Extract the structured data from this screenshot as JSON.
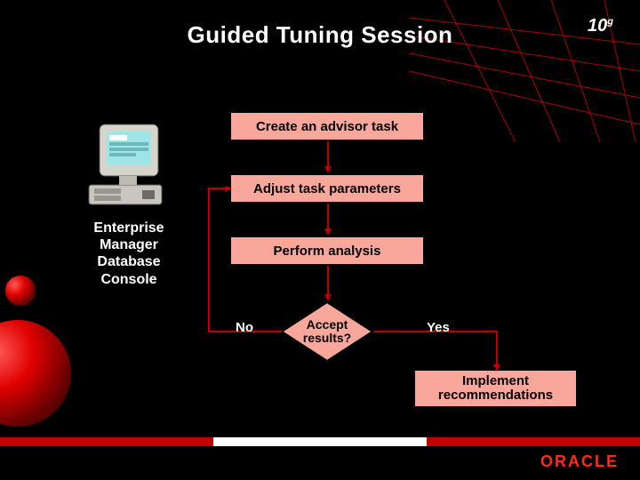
{
  "title": "Guided Tuning Session",
  "badge": {
    "main": "10",
    "sup": "g"
  },
  "computer_label": "Enterprise\nManager\nDatabase\nConsole",
  "flow": {
    "step1": "Create an advisor task",
    "step2": "Adjust task parameters",
    "step3": "Perform analysis",
    "decision": "Accept\nresults?",
    "no_label": "No",
    "yes_label": "Yes",
    "step5": "Implement\nrecommendations"
  },
  "footer": {
    "brand": "ORACLE"
  },
  "colors": {
    "box_fill": "#f9a79a",
    "arrow": "#c00000",
    "accent": "#c00000"
  }
}
